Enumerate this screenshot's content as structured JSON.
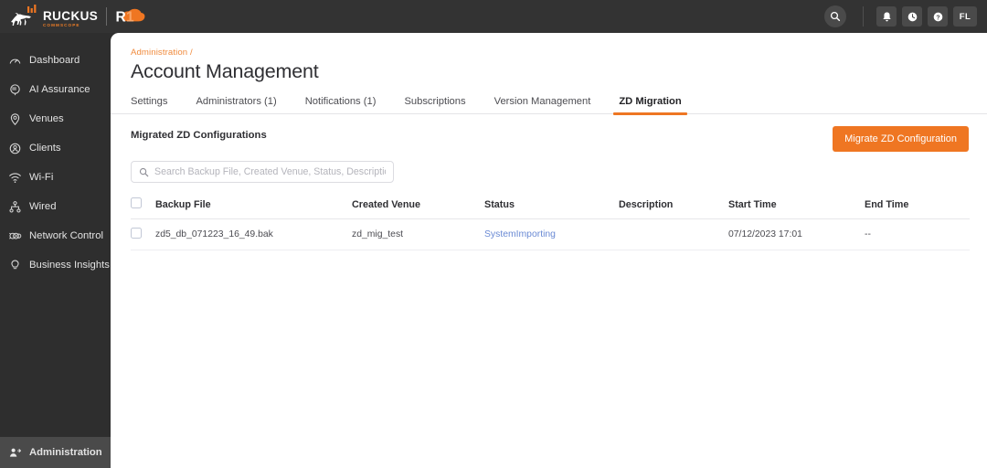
{
  "brand": {
    "name": "RUCKUS",
    "sub": "COMMSCOPE",
    "product": "R1"
  },
  "header": {
    "search_icon": "search-icon",
    "icons": [
      {
        "name": "notifications-bell-icon",
        "glyph": "●"
      },
      {
        "name": "clock-history-icon",
        "glyph": "●"
      },
      {
        "name": "help-question-icon",
        "glyph": "●"
      }
    ],
    "avatar_initials": "FL"
  },
  "sidebar": {
    "items": [
      {
        "label": "Dashboard",
        "icon": "dashboard-gauge-icon"
      },
      {
        "label": "AI Assurance",
        "icon": "ai-assurance-icon"
      },
      {
        "label": "Venues",
        "icon": "venue-pin-icon"
      },
      {
        "label": "Clients",
        "icon": "clients-user-icon"
      },
      {
        "label": "Wi-Fi",
        "icon": "wifi-icon"
      },
      {
        "label": "Wired",
        "icon": "wired-network-icon"
      },
      {
        "label": "Network Control",
        "icon": "network-control-icon"
      },
      {
        "label": "Business Insights",
        "icon": "business-insights-bulb-icon"
      }
    ],
    "bottom": {
      "label": "Administration",
      "icon": "administration-user-gear-icon",
      "active": true
    }
  },
  "page": {
    "breadcrumb": "Administration /",
    "title": "Account Management"
  },
  "tabs": [
    {
      "label": "Settings",
      "active": false
    },
    {
      "label": "Administrators (1)",
      "active": false
    },
    {
      "label": "Notifications (1)",
      "active": false
    },
    {
      "label": "Subscriptions",
      "active": false
    },
    {
      "label": "Version Management",
      "active": false
    },
    {
      "label": "ZD Migration",
      "active": true
    }
  ],
  "section": {
    "title": "Migrated ZD Configurations",
    "action_label": "Migrate ZD Configuration",
    "action_color": "#ef7622"
  },
  "search": {
    "placeholder": "Search Backup File, Created Venue, Status, Description",
    "value": ""
  },
  "table": {
    "columns": [
      "Backup File",
      "Created Venue",
      "Status",
      "Description",
      "Start Time",
      "End Time"
    ],
    "rows": [
      {
        "backup_file": "zd5_db_071223_16_49.bak",
        "created_venue": "zd_mig_test",
        "status": "SystemImporting",
        "status_color": "#6a8ad4",
        "description": "",
        "start_time": "07/12/2023 17:01",
        "end_time": "--"
      }
    ]
  }
}
